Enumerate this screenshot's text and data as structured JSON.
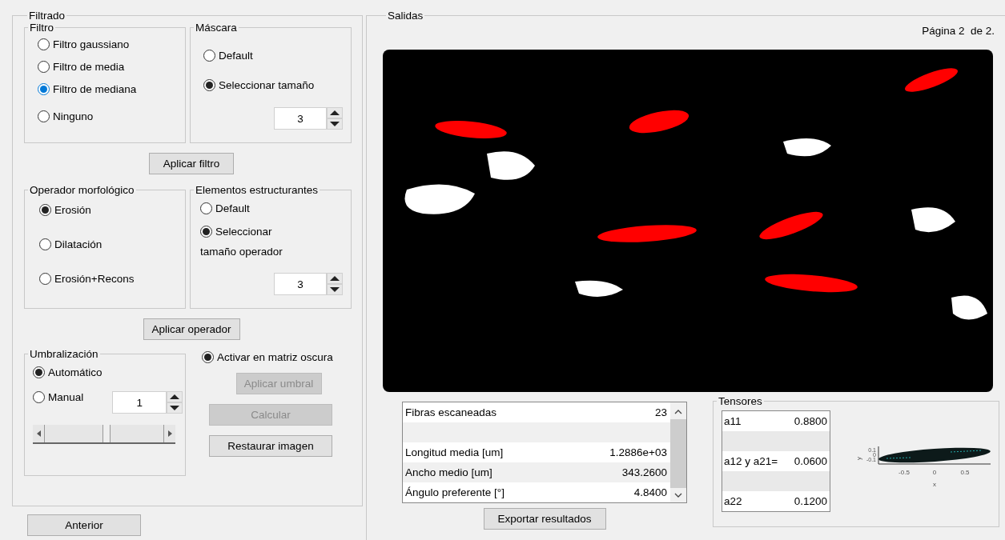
{
  "filtering": {
    "title": "Filtrado",
    "filter": {
      "title": "Filtro",
      "focused": true,
      "options": [
        {
          "label": "Filtro gaussiano",
          "selected": false
        },
        {
          "label": "Filtro de media",
          "selected": false
        },
        {
          "label": "Filtro de mediana",
          "selected": true
        },
        {
          "label": "Ninguno",
          "selected": false
        }
      ]
    },
    "mask": {
      "title": "Máscara",
      "options": [
        {
          "label": "Default",
          "selected": false
        },
        {
          "label": "Seleccionar tamaño",
          "selected": true
        }
      ],
      "size": "3"
    },
    "apply_filter": "Aplicar filtro",
    "morph": {
      "title": "Operador morfológico",
      "options": [
        {
          "label": "Erosión",
          "selected": true
        },
        {
          "label": "Dilatación",
          "selected": false
        },
        {
          "label": "Erosión+Recons",
          "selected": false
        }
      ]
    },
    "struct": {
      "title": "Elementos estructurantes",
      "options": [
        {
          "label": "Default",
          "selected": false
        },
        {
          "label": "Seleccionar",
          "selected": true
        }
      ],
      "note": "tamaño operador",
      "size": "3"
    },
    "apply_operator": "Aplicar operador",
    "threshold": {
      "title": "Umbralización",
      "options": [
        {
          "label": "Automático",
          "selected": true
        },
        {
          "label": "Manual",
          "selected": false
        }
      ],
      "value": "1",
      "slider": {
        "level": 0.52
      }
    },
    "dark_matrix": {
      "label": "Activar en matriz oscura",
      "selected": true
    },
    "buttons": [
      {
        "label": "Aplicar umbral",
        "disabled": true
      },
      {
        "label": "Calcular",
        "disabled": true
      },
      {
        "label": "Restaurar imagen",
        "disabled": false
      }
    ]
  },
  "back_button": "Anterior",
  "outputs": {
    "title": "Salidas",
    "page": "Página 2  de 2.",
    "results": {
      "rows": [
        {
          "kind": "data",
          "name": "Fibras escaneadas",
          "value": "23"
        },
        {
          "kind": "blank"
        },
        {
          "kind": "data",
          "name": "Longitud media [um]",
          "value": "1.2886e+03"
        },
        {
          "kind": "data",
          "name": "Ancho medio [um]",
          "value": "343.2600"
        },
        {
          "kind": "data",
          "name": "Ángulo preferente [°]",
          "value": "4.8400"
        }
      ]
    },
    "export_button": "Exportar resultados",
    "tensors": {
      "title": "Tensores",
      "rows": [
        {
          "kind": "data",
          "name": "a11",
          "value": "0.8800"
        },
        {
          "kind": "blank"
        },
        {
          "kind": "data",
          "name": "a12 y a21=",
          "value": "0.0600"
        },
        {
          "kind": "blank"
        },
        {
          "kind": "data",
          "name": "a22",
          "value": "0.1200"
        }
      ],
      "plot": {
        "xlabel": "x",
        "ylabel": "y",
        "xticks": [
          "-0.5",
          "0",
          "0.5"
        ],
        "yticks": [
          "0.1",
          "0",
          "-0.1"
        ]
      }
    }
  }
}
